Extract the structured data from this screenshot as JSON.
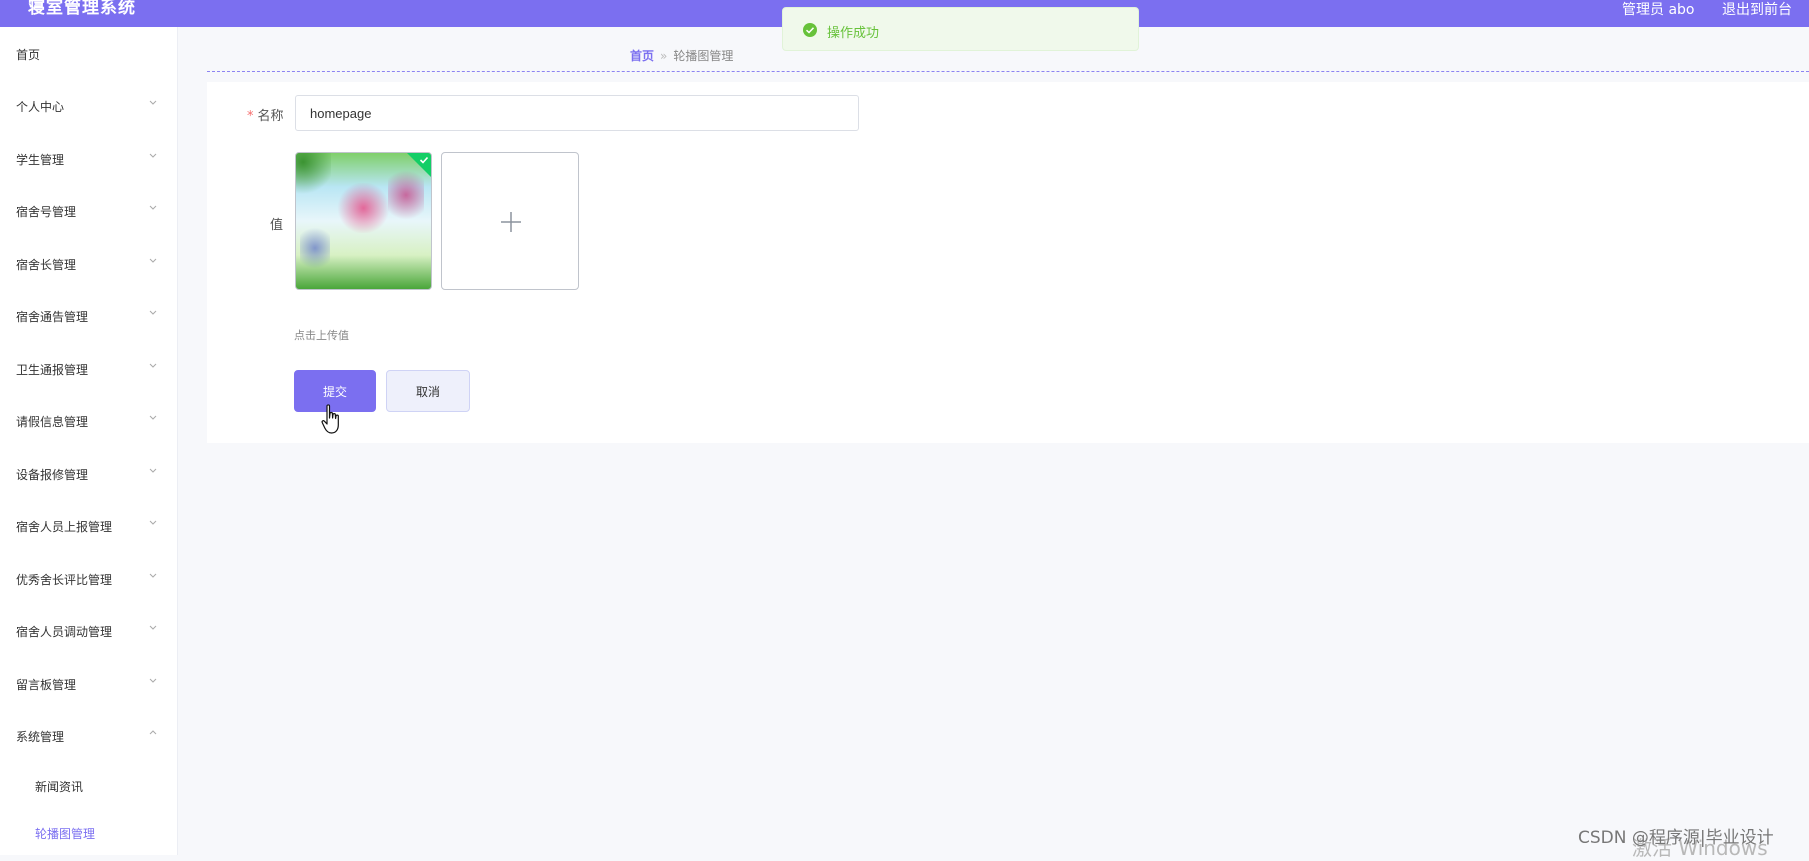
{
  "header": {
    "title": "寝室管理系统",
    "user": "管理员 abo",
    "exit": "退出到前台",
    "accent": "#7b6ff0"
  },
  "sidebar": {
    "items": [
      {
        "label": "首页",
        "has_chevron": false
      },
      {
        "label": "个人中心",
        "has_chevron": true
      },
      {
        "label": "学生管理",
        "has_chevron": true
      },
      {
        "label": "宿舍号管理",
        "has_chevron": true
      },
      {
        "label": "宿舍长管理",
        "has_chevron": true
      },
      {
        "label": "宿舍通告管理",
        "has_chevron": true
      },
      {
        "label": "卫生通报管理",
        "has_chevron": true
      },
      {
        "label": "请假信息管理",
        "has_chevron": true
      },
      {
        "label": "设备报修管理",
        "has_chevron": true
      },
      {
        "label": "宿舍人员上报管理",
        "has_chevron": true
      },
      {
        "label": "优秀舍长评比管理",
        "has_chevron": true
      },
      {
        "label": "宿舍人员调动管理",
        "has_chevron": true
      },
      {
        "label": "留言板管理",
        "has_chevron": true
      },
      {
        "label": "系统管理",
        "has_chevron": true,
        "expanded": true
      }
    ],
    "subitems": [
      {
        "label": "新闻资讯",
        "active": false
      },
      {
        "label": "轮播图管理",
        "active": true
      }
    ]
  },
  "breadcrumb": {
    "home": "首页",
    "separator": "»",
    "current": "轮播图管理"
  },
  "form": {
    "name_label": "名称",
    "name_required": "*",
    "name_value": "homepage",
    "value_label": "值",
    "upload_tip": "点击上传值",
    "submit": "提交",
    "cancel": "取消"
  },
  "toast": {
    "message": "操作成功",
    "color": "#67c23a"
  },
  "watermark": {
    "text": "CSDN @程序源|毕业设计",
    "windows": "激活 Windows"
  }
}
